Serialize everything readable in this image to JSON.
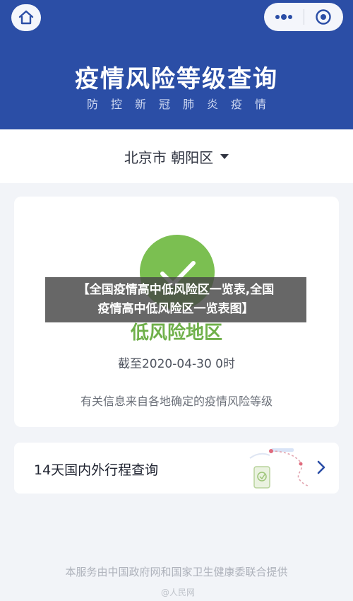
{
  "header": {
    "title": "疫情风险等级查询",
    "subtitle": "防控新冠肺炎疫情",
    "home_icon": "home-icon",
    "more_icon": "more-dots-icon",
    "close_icon": "close-target-icon",
    "bg_color": "#2b4ea6"
  },
  "location": {
    "text": "北京市 朝阳区",
    "dropdown_icon": "caret-down-icon"
  },
  "result": {
    "risk_level": "低风险地区",
    "deadline": "截至2020-04-30 0时",
    "note": "有关信息来自各地确定的疫情风险等级",
    "status_icon": "check-icon",
    "status_color": "#7bbf51"
  },
  "travel": {
    "label": "14天国内外行程查询",
    "chevron_icon": "chevron-right-icon"
  },
  "footer": {
    "provider": "本服务由中国政府网和国家卫生健康委联合提供",
    "watermark": "@人民网"
  },
  "overlay": {
    "line1": "【全国疫情高中低风险区一览表,全国",
    "line2": "疫情高中低风险区一览表图】"
  }
}
